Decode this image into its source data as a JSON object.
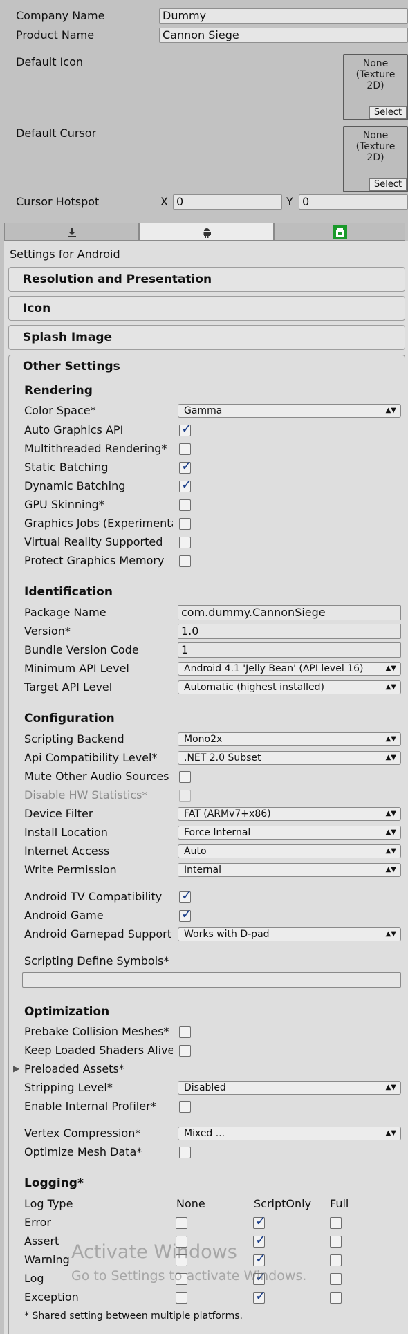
{
  "top": {
    "company_label": "Company Name",
    "company_value": "Dummy",
    "product_label": "Product Name",
    "product_value": "Cannon Siege",
    "default_icon_label": "Default Icon",
    "default_cursor_label": "Default Cursor",
    "texture_none": "None",
    "texture_type": "(Texture",
    "texture_2d": "2D)",
    "select_label": "Select",
    "cursor_hotspot_label": "Cursor Hotspot",
    "hotspot_x_label": "X",
    "hotspot_x_value": "0",
    "hotspot_y_label": "Y",
    "hotspot_y_value": "0"
  },
  "platform_tabs": [
    {
      "name": "standalone-tab",
      "icon": "download-icon",
      "active": false
    },
    {
      "name": "android-tab",
      "icon": "android-icon",
      "active": true
    },
    {
      "name": "windows-store-tab",
      "icon": "windows-store-icon",
      "active": false
    }
  ],
  "settings_for": "Settings for Android",
  "foldouts": {
    "resolution": "Resolution and Presentation",
    "icon": "Icon",
    "splash": "Splash Image",
    "other": "Other Settings"
  },
  "rendering": {
    "title": "Rendering",
    "color_space_label": "Color Space*",
    "color_space_value": "Gamma",
    "checks": [
      {
        "label": "Auto Graphics API",
        "checked": true
      },
      {
        "label": "Multithreaded Rendering*",
        "checked": false
      },
      {
        "label": "Static Batching",
        "checked": true
      },
      {
        "label": "Dynamic Batching",
        "checked": true
      },
      {
        "label": "GPU Skinning*",
        "checked": false
      },
      {
        "label": "Graphics Jobs (Experimental)",
        "checked": false
      },
      {
        "label": "Virtual Reality Supported",
        "checked": false
      },
      {
        "label": "Protect Graphics Memory",
        "checked": false
      }
    ]
  },
  "identification": {
    "title": "Identification",
    "package_label": "Package Name",
    "package_value": "com.dummy.CannonSiege",
    "version_label": "Version*",
    "version_value": "1.0",
    "bundle_label": "Bundle Version Code",
    "bundle_value": "1",
    "min_api_label": "Minimum API Level",
    "min_api_value": "Android 4.1 'Jelly Bean' (API level 16)",
    "target_api_label": "Target API Level",
    "target_api_value": "Automatic (highest installed)"
  },
  "configuration": {
    "title": "Configuration",
    "backend_label": "Scripting Backend",
    "backend_value": "Mono2x",
    "api_compat_label": "Api Compatibility Level*",
    "api_compat_value": ".NET 2.0 Subset",
    "mute_label": "Mute Other Audio Sources",
    "mute_checked": false,
    "disable_hw_label": "Disable HW Statistics*",
    "disable_hw_checked": false,
    "device_filter_label": "Device Filter",
    "device_filter_value": "FAT (ARMv7+x86)",
    "install_location_label": "Install Location",
    "install_location_value": "Force Internal",
    "internet_label": "Internet Access",
    "internet_value": "Auto",
    "write_label": "Write Permission",
    "write_value": "Internal",
    "tv_label": "Android TV Compatibility",
    "tv_checked": true,
    "game_label": "Android Game",
    "game_checked": true,
    "gamepad_label": "Android Gamepad Support Level",
    "gamepad_value": "Works with D-pad",
    "define_symbols_label": "Scripting Define Symbols*",
    "define_symbols_value": ""
  },
  "optimization": {
    "title": "Optimization",
    "prebake_label": "Prebake Collision Meshes*",
    "prebake_checked": false,
    "keep_shaders_label": "Keep Loaded Shaders Alive*",
    "keep_shaders_checked": false,
    "preloaded_label": "Preloaded Assets*",
    "stripping_label": "Stripping Level*",
    "stripping_value": "Disabled",
    "profiler_label": "Enable Internal Profiler*",
    "profiler_checked": false,
    "vertex_label": "Vertex Compression*",
    "vertex_value": "Mixed ...",
    "optimize_mesh_label": "Optimize Mesh Data*",
    "optimize_mesh_checked": false
  },
  "logging": {
    "title": "Logging*",
    "log_type_header": "Log Type",
    "columns": [
      "None",
      "ScriptOnly",
      "Full"
    ],
    "rows": [
      {
        "label": "Error",
        "selected": 1
      },
      {
        "label": "Assert",
        "selected": 1
      },
      {
        "label": "Warning",
        "selected": 1
      },
      {
        "label": "Log",
        "selected": 1
      },
      {
        "label": "Exception",
        "selected": 1
      }
    ]
  },
  "footnote": "* Shared setting between multiple platforms.",
  "watermark": {
    "line1": "Activate Windows",
    "line2": "Go to Settings to activate Windows."
  }
}
